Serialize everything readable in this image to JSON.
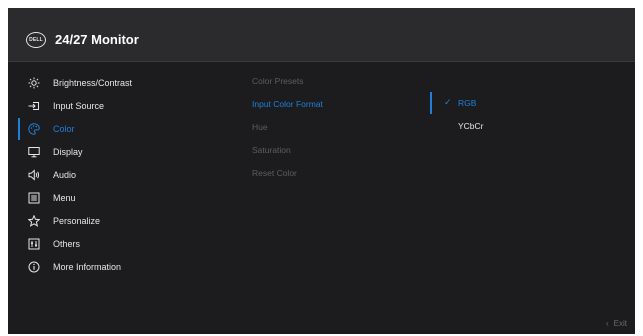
{
  "header": {
    "logo_text": "DELL",
    "title": "24/27 Monitor"
  },
  "menu": {
    "items": [
      {
        "label": "Brightness/Contrast",
        "icon": "brightness-icon"
      },
      {
        "label": "Input Source",
        "icon": "input-source-icon"
      },
      {
        "label": "Color",
        "icon": "color-palette-icon",
        "active": true
      },
      {
        "label": "Display",
        "icon": "display-icon"
      },
      {
        "label": "Audio",
        "icon": "speaker-icon"
      },
      {
        "label": "Menu",
        "icon": "menu-icon"
      },
      {
        "label": "Personalize",
        "icon": "star-icon"
      },
      {
        "label": "Others",
        "icon": "others-icon"
      },
      {
        "label": "More Information",
        "icon": "info-icon"
      }
    ]
  },
  "submenu": {
    "items": [
      {
        "label": "Color Presets"
      },
      {
        "label": "Input Color Format",
        "active": true
      },
      {
        "label": "Hue"
      },
      {
        "label": "Saturation"
      },
      {
        "label": "Reset Color"
      }
    ]
  },
  "options": {
    "items": [
      {
        "label": "RGB",
        "selected": true
      },
      {
        "label": "YCbCr"
      }
    ]
  },
  "footer": {
    "exit_label": "Exit"
  },
  "colors": {
    "accent": "#1f80d9",
    "background": "#1c1c1e",
    "header": "#2b2b2d",
    "dim_text": "#5d5d61"
  }
}
